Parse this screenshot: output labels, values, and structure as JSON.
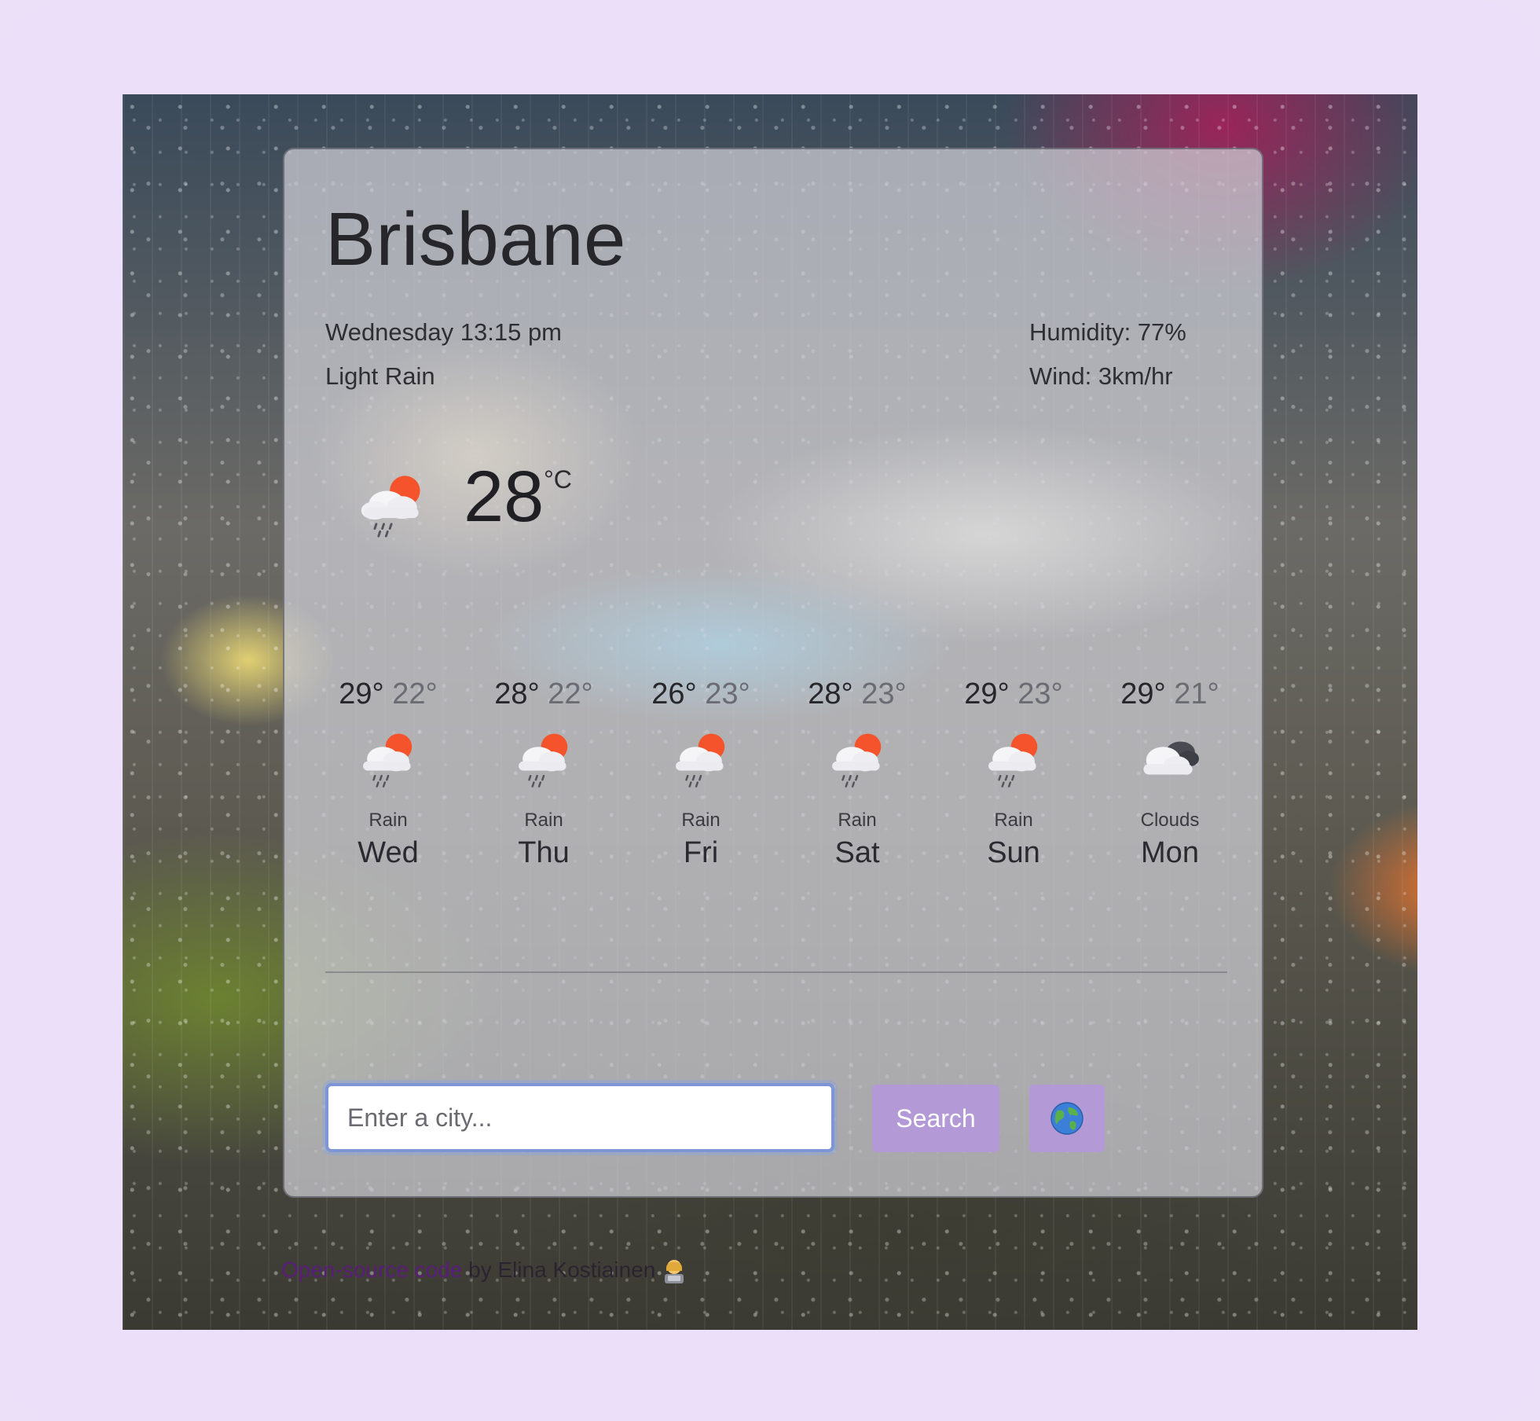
{
  "current": {
    "city": "Brisbane",
    "datetime": "Wednesday 13:15 pm",
    "description": "Light Rain",
    "humidity": "Humidity: 77%",
    "wind": "Wind: 3km/hr",
    "temperature": "28",
    "unit": "°C",
    "icon": "rain-cloud-sun-icon"
  },
  "forecast": [
    {
      "max": "29°",
      "min": "22°",
      "condition": "Rain",
      "day": "Wed",
      "icon": "rain-cloud-sun-icon"
    },
    {
      "max": "28°",
      "min": "22°",
      "condition": "Rain",
      "day": "Thu",
      "icon": "rain-cloud-sun-icon"
    },
    {
      "max": "26°",
      "min": "23°",
      "condition": "Rain",
      "day": "Fri",
      "icon": "rain-cloud-sun-icon"
    },
    {
      "max": "28°",
      "min": "23°",
      "condition": "Rain",
      "day": "Sat",
      "icon": "rain-cloud-sun-icon"
    },
    {
      "max": "29°",
      "min": "23°",
      "condition": "Rain",
      "day": "Sun",
      "icon": "rain-cloud-sun-icon"
    },
    {
      "max": "29°",
      "min": "21°",
      "condition": "Clouds",
      "day": "Mon",
      "icon": "clouds-icon"
    }
  ],
  "search": {
    "placeholder": "Enter a city...",
    "button_label": "Search",
    "location_icon": "globe-icon"
  },
  "footer": {
    "link_text": "Open-source code",
    "credit_text": " by Elina Kostiainen",
    "avatar_icon": "woman-technologist-icon"
  },
  "colors": {
    "accent": "#b39ad6",
    "page_background": "#ebdff9",
    "link": "#5a1d7a"
  }
}
